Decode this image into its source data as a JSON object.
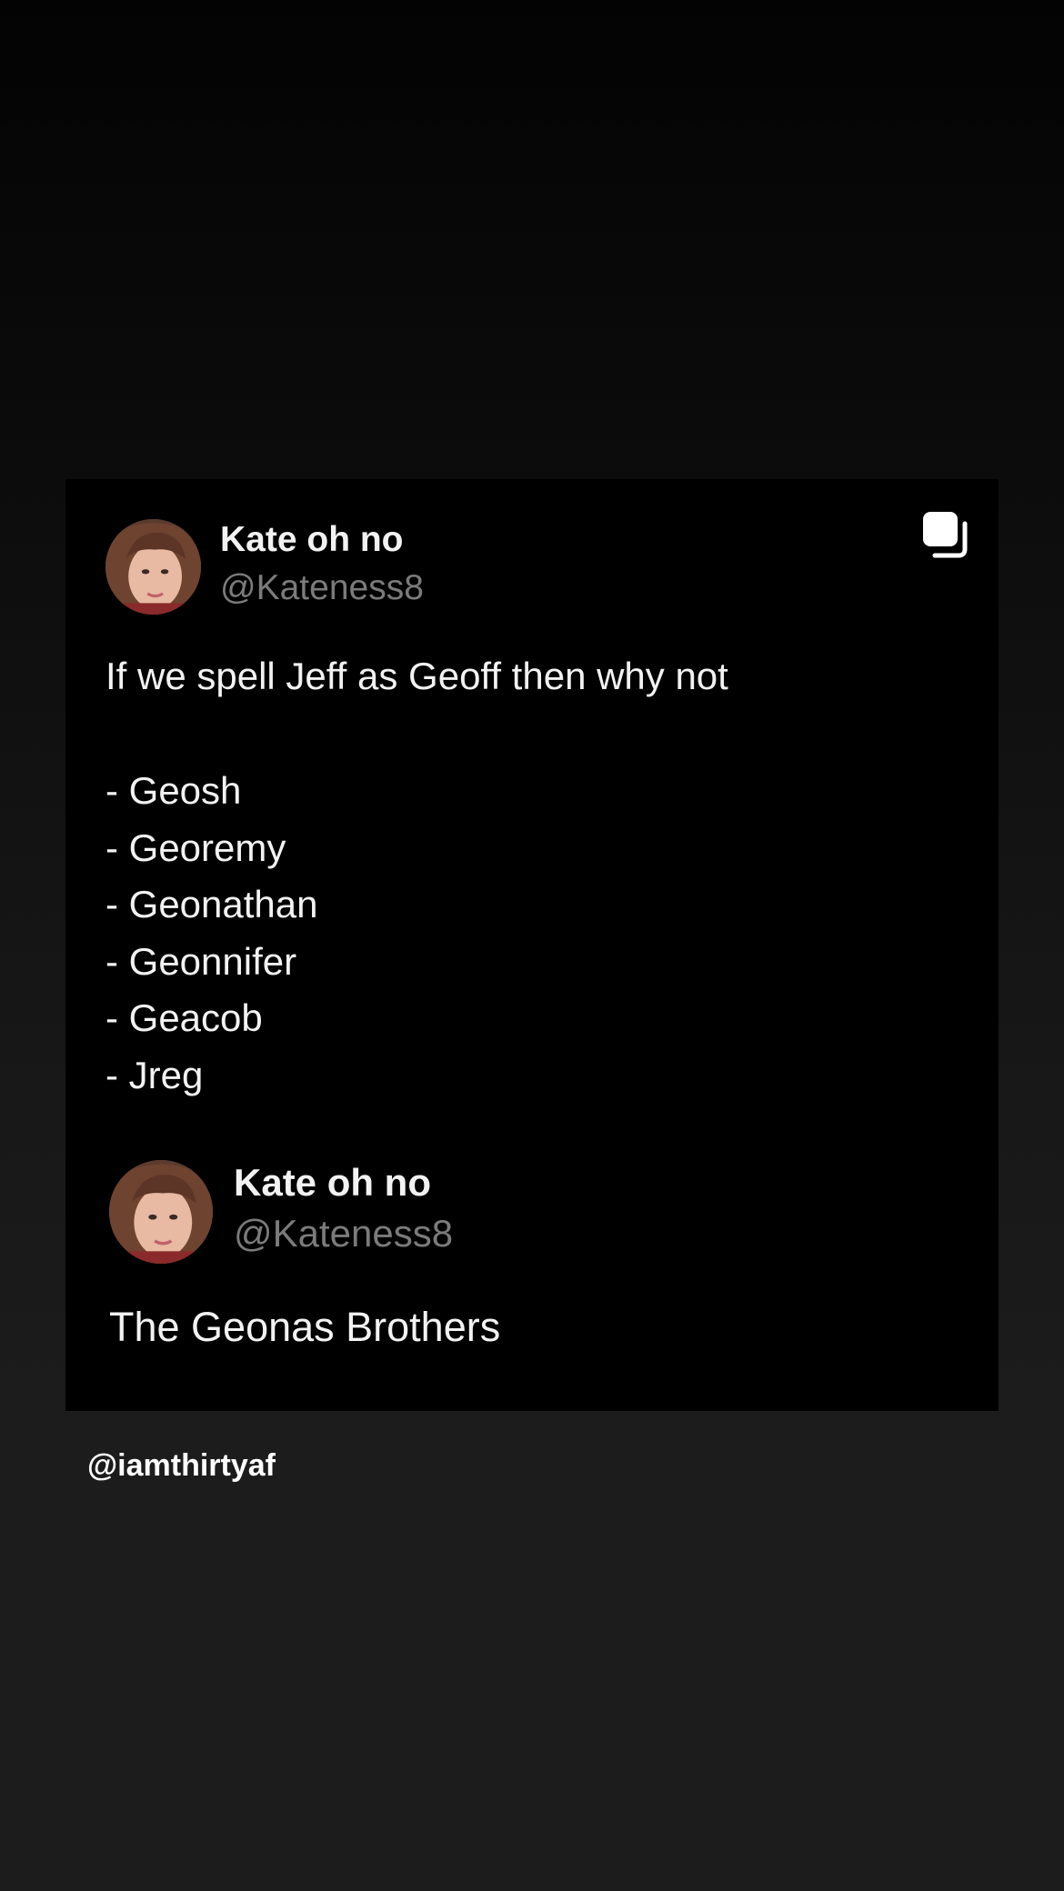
{
  "post": {
    "author": {
      "name": "Kate oh no",
      "handle": "@Kateness8"
    },
    "tweet_1": {
      "text": "If we spell Jeff as Geoff then why not",
      "list": [
        "- Geosh",
        "- Georemy",
        "- Geonathan",
        "- Geonnifer",
        "- Geacob",
        "- Jreg"
      ]
    },
    "tweet_2": {
      "text": "The Geonas Brothers"
    },
    "multiple_images_icon": "copy-icon"
  },
  "watermark": "@iamthirtyaf",
  "colors": {
    "card_background": "#000000",
    "handle_gray": "#7b7b7b",
    "text_white": "#f2f2f2"
  }
}
